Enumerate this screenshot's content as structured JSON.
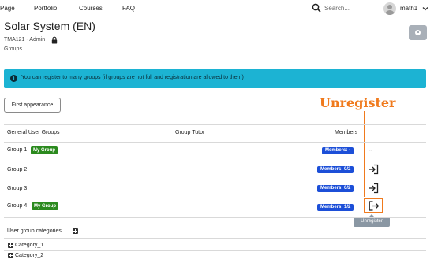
{
  "nav": {
    "items": [
      "Page",
      "Portfolio",
      "Courses",
      "FAQ"
    ],
    "search_placeholder": "Search...",
    "username": "math1"
  },
  "header": {
    "title": "Solar System (EN)",
    "course_code": "TMA121 - Admin",
    "breadcrumb": "Groups"
  },
  "info": {
    "message": "You can register to many groups (if groups are not full and registration are allowed to them)"
  },
  "first_appearance_label": "First appearance",
  "annotation": {
    "label": "Unregister",
    "color": "#f07a1d"
  },
  "table": {
    "headers": [
      "General User Groups",
      "Group Tutor",
      "Members"
    ],
    "rows": [
      {
        "name": "Group 1",
        "badge": "My Group",
        "members": "Members: -",
        "action": "none",
        "action_text": "--"
      },
      {
        "name": "Group 2",
        "badge": "",
        "members": "Members: 0/2",
        "action": "register"
      },
      {
        "name": "Group 3",
        "badge": "",
        "members": "Members: 0/2",
        "action": "register"
      },
      {
        "name": "Group 4",
        "badge": "My Group",
        "members": "Members: 1/2",
        "action": "unregister"
      }
    ]
  },
  "tooltip": "Unregister",
  "categories": {
    "heading": "User group categories",
    "items": [
      "Category_1",
      "Category_2"
    ]
  },
  "colors": {
    "info_bg": "#1cb3d3",
    "my_group_badge": "#2b8a1e",
    "members_badge": "#1c4fd8",
    "annotation": "#f07a1d"
  }
}
